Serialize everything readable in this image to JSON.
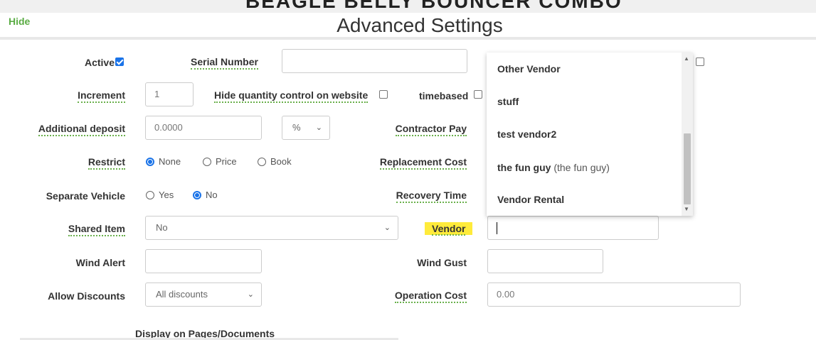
{
  "page_title": "BEAGLE BELLY BOUNCER COMBO",
  "hide_link": "Hide",
  "section_title": "Advanced Settings",
  "labels": {
    "active": "Active",
    "serial_number": "Serial Number",
    "increment": "Increment",
    "hide_qty": "Hide quantity control on website",
    "timebased": "timebased",
    "additional_deposit": "Additional deposit",
    "contractor_pay": "Contractor Pay",
    "restrict": "Restrict",
    "replacement_cost": "Replacement Cost",
    "separate_vehicle": "Separate Vehicle",
    "recovery_time": "Recovery Time",
    "shared_item": "Shared Item",
    "vendor": "Vendor",
    "wind_alert": "Wind Alert",
    "wind_gust": "Wind Gust",
    "allow_discounts": "Allow Discounts",
    "operation_cost": "Operation Cost",
    "display_on_pages": "Display on Pages/Documents"
  },
  "values": {
    "increment": "1",
    "additional_deposit": "0.0000",
    "deposit_unit": "%",
    "shared_item": "No",
    "allow_discounts": "All discounts",
    "operation_cost": "0.00"
  },
  "restrict_options": [
    "None",
    "Price",
    "Book"
  ],
  "restrict_selected": "None",
  "separate_vehicle_options": [
    "Yes",
    "No"
  ],
  "separate_vehicle_selected": "No",
  "vendor_dropdown": {
    "items": [
      {
        "name": "Other Vendor",
        "sub": ""
      },
      {
        "name": "stuff",
        "sub": ""
      },
      {
        "name": "test vendor2",
        "sub": ""
      },
      {
        "name": "the fun guy",
        "sub": "(the fun guy)"
      },
      {
        "name": "Vendor Rental",
        "sub": ""
      }
    ]
  },
  "icons": {
    "chevron": "chevron-down-icon",
    "scroll_up": "scroll-up-icon",
    "scroll_down": "scroll-down-icon"
  },
  "colors": {
    "accent": "#1a73e8",
    "link_green": "#5aac44",
    "highlight": "#ffeb3b"
  }
}
